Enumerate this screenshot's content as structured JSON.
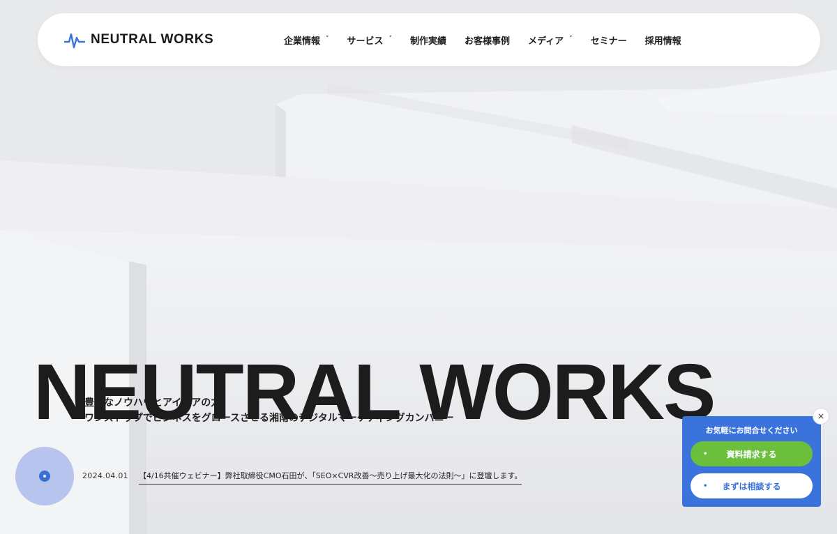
{
  "brand": {
    "name": "NEUTRAL WORKS",
    "accent": "#3b73dc"
  },
  "nav": {
    "items": [
      {
        "label": "企業情報",
        "dropdown": true
      },
      {
        "label": "サービス",
        "dropdown": true
      },
      {
        "label": "制作実績",
        "dropdown": false
      },
      {
        "label": "お客様事例",
        "dropdown": false
      },
      {
        "label": "メディア",
        "dropdown": true
      },
      {
        "label": "セミナー",
        "dropdown": false
      },
      {
        "label": "採用情報",
        "dropdown": false
      }
    ],
    "chevron": "˅"
  },
  "hero": {
    "title": "NEUTRAL WORKS",
    "tagline_line1": "豊富なノウハウとアイデアの力。",
    "tagline_line2": "ワンストップでビジネスをグロースさせる湘南のデジタルマーケティングカンパニー"
  },
  "news": {
    "date": "2024.04.01",
    "text": "【4/16共催ウェビナー】弊社取締役CMO石田が、「SEO×CVR改善〜売り上げ最大化の法則〜」に登壇します。"
  },
  "contact": {
    "title": "お気軽にお問合せください",
    "request_docs": "資料請求する",
    "consult": "まずは相談する",
    "bullet": "•",
    "close": "×",
    "colors": {
      "panel": "#3b73dc",
      "doc_button": "#6cbf3b"
    }
  }
}
